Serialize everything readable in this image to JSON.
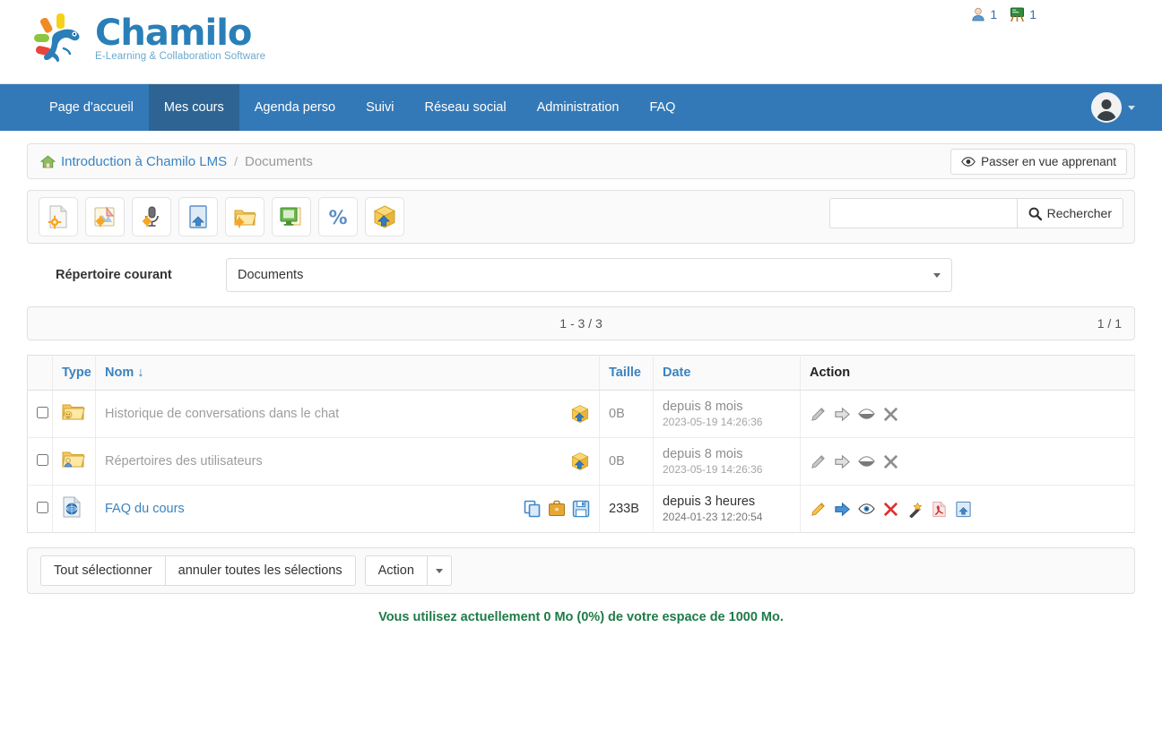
{
  "brand": {
    "name": "Chamilo",
    "tagline": "E-Learning & Collaboration Software",
    "logo_icon": "chamilo-chameleon-logo",
    "accent_blue": "#2a7fb8",
    "nav_blue": "#3379b7",
    "nav_active_blue": "#2d6494"
  },
  "header": {
    "counters": [
      {
        "icon": "user-icon",
        "value": "1"
      },
      {
        "icon": "chalkboard-icon",
        "value": "1"
      }
    ],
    "avatar_icon": "user-avatar",
    "avatar_caret_icon": "caret-down-icon"
  },
  "nav": {
    "items": [
      {
        "label": "Page d'accueil",
        "active": false
      },
      {
        "label": "Mes cours",
        "active": true
      },
      {
        "label": "Agenda perso",
        "active": false
      },
      {
        "label": "Suivi",
        "active": false
      },
      {
        "label": "Réseau social",
        "active": false
      },
      {
        "label": "Administration",
        "active": false
      },
      {
        "label": "FAQ",
        "active": false
      }
    ]
  },
  "breadcrumb": {
    "home_icon": "home-icon",
    "course": "Introduction à Chamilo LMS",
    "separator": "/",
    "current": "Documents",
    "view_button": {
      "label": "Passer en vue apprenant",
      "icon": "eye-icon"
    }
  },
  "toolbar": {
    "buttons": [
      {
        "name": "new-document",
        "icon": "new-document-icon"
      },
      {
        "name": "new-drawing",
        "icon": "drawing-icon"
      },
      {
        "name": "record-audio",
        "icon": "microphone-icon"
      },
      {
        "name": "upload-document",
        "icon": "upload-page-icon"
      },
      {
        "name": "new-folder",
        "icon": "new-folder-icon"
      },
      {
        "name": "new-slideshow",
        "icon": "slideshow-icon"
      },
      {
        "name": "certificate",
        "icon": "percent-icon"
      },
      {
        "name": "download-package",
        "icon": "package-download-icon"
      }
    ],
    "search": {
      "value": "",
      "placeholder": "",
      "button_label": "Rechercher",
      "icon": "search-icon"
    }
  },
  "directory": {
    "label": "Répertoire courant",
    "selected": "Documents",
    "caret_icon": "caret-down-icon"
  },
  "pager": {
    "range": "1 - 3 / 3",
    "pages": "1 / 1"
  },
  "table": {
    "headers": {
      "type": "Type",
      "name": "Nom",
      "sort_icon": "sort-desc-arrow",
      "size": "Taille",
      "date": "Date",
      "action": "Action"
    },
    "rows": [
      {
        "checked": false,
        "type_icon": "folder-chat-icon",
        "name": "Historique de conversations dans le chat",
        "name_is_link": false,
        "name_icons": [
          "package-download-icon"
        ],
        "size": "0B",
        "date_relative": "depuis 8 mois",
        "date_absolute": "2023-05-19 14:26:36",
        "muted": true,
        "actions": [
          "edit-pencil-icon",
          "move-arrow-icon",
          "visibility-off-icon",
          "delete-cross-icon"
        ]
      },
      {
        "checked": false,
        "type_icon": "folder-users-icon",
        "name": "Répertoires des utilisateurs",
        "name_is_link": false,
        "name_icons": [
          "package-download-icon"
        ],
        "size": "0B",
        "date_relative": "depuis 8 mois",
        "date_absolute": "2023-05-19 14:26:36",
        "muted": true,
        "actions": [
          "edit-pencil-icon",
          "move-arrow-icon",
          "visibility-off-icon",
          "delete-cross-icon"
        ]
      },
      {
        "checked": false,
        "type_icon": "html-page-icon",
        "name": "FAQ du cours",
        "name_is_link": true,
        "name_icons": [
          "copy-icon",
          "briefcase-icon",
          "save-icon"
        ],
        "size": "233B",
        "date_relative": "depuis 3 heures",
        "date_absolute": "2024-01-23 12:20:54",
        "muted": false,
        "actions": [
          "edit-pencil-icon",
          "move-arrow-icon",
          "visibility-on-icon",
          "delete-cross-icon",
          "magic-wand-icon",
          "pdf-icon",
          "replace-upload-icon"
        ]
      }
    ]
  },
  "bottom_bar": {
    "select_all": "Tout sélectionner",
    "unselect_all": "annuler toutes les sélections",
    "action": "Action",
    "action_caret_icon": "caret-down-icon"
  },
  "quota": {
    "text": "Vous utilisez actuellement 0 Mo (0%) de votre espace de 1000 Mo.",
    "color": "#1e7b48"
  }
}
